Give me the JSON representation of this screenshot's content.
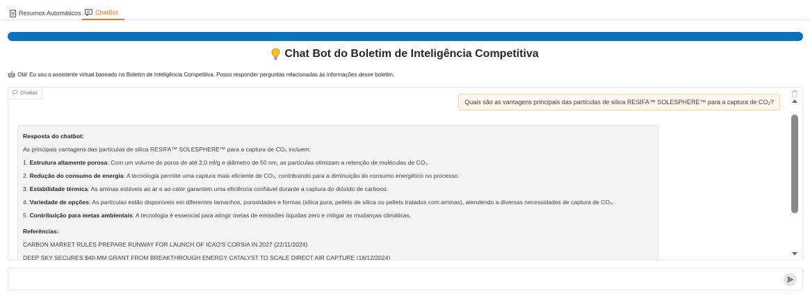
{
  "tabs": [
    {
      "label": "Resumos Automáticos",
      "icon": "document-icon"
    },
    {
      "label": "ChatBot",
      "icon": "chat-icon",
      "active": true
    }
  ],
  "accent_color": "#f97316",
  "progress_color": "#0972ba",
  "title": "Chat Bot do Boletim de Inteligência Competitiva",
  "intro_emoji": "🤖",
  "intro": "Olá! Eu sou o assistente virtual baseado no Boletim de Inteligência Competitiva. Posso responder perguntas relacionadas às informações desse boletim.",
  "chat": {
    "label": "Chatbot",
    "user_message": "Quais são as vantagens principais das partículas de sílica RESIFA™ SOLESPHERE™ para a captura de CO₂?",
    "bot": {
      "heading": "Resposta do chatbot:",
      "intro": "As principais vantagens das partículas de sílica RESIFA™ SOLESPHERE™ para a captura de CO₂ incluem:",
      "items": [
        {
          "num": "1.",
          "title": "Estrutura altamente porosa",
          "text": ": Com um volume de poros de até 2,0 ml/g e diâmetro de 50 nm, as partículas otimizam a retenção de moléculas de CO₂."
        },
        {
          "num": "2.",
          "title": "Redução do consumo de energia",
          "text": ": A tecnologia permite uma captura mais eficiente de CO₂, contribuindo para a diminuição do consumo energético no processo."
        },
        {
          "num": "3.",
          "title": "Estabilidade térmica",
          "text": ": As aminas estáveis ao ar e ao calor garantem uma eficiência confiável durante a captura do dióxido de carbono."
        },
        {
          "num": "4.",
          "title": "Variedade de opções",
          "text": ": As partículas estão disponíveis em diferentes tamanhos, porosidades e formas (sílica pura, pellets de sílica ou pellets tratados com aminas), atendendo a diversas necessidades de captura de CO₂."
        },
        {
          "num": "5.",
          "title": "Contribuição para metas ambientais",
          "text": ": A tecnologia é essencial para atingir metas de emissões líquidas zero e mitigar as mudanças climáticas."
        }
      ],
      "references_heading": "Referências:",
      "references": [
        "CARBON MARKET RULES PREPARE RUNWAY FOR LAUNCH OF ICAO'S CORSIA IN 2027 (22/11/2024)",
        "DEEP SKY SECURES $40-MM GRANT FROM BREAKTHROUGH ENERGY CATALYST TO SCALE DIRECT AIR CAPTURE (18/12/2024)"
      ]
    }
  },
  "input": {
    "value": "",
    "placeholder": ""
  }
}
